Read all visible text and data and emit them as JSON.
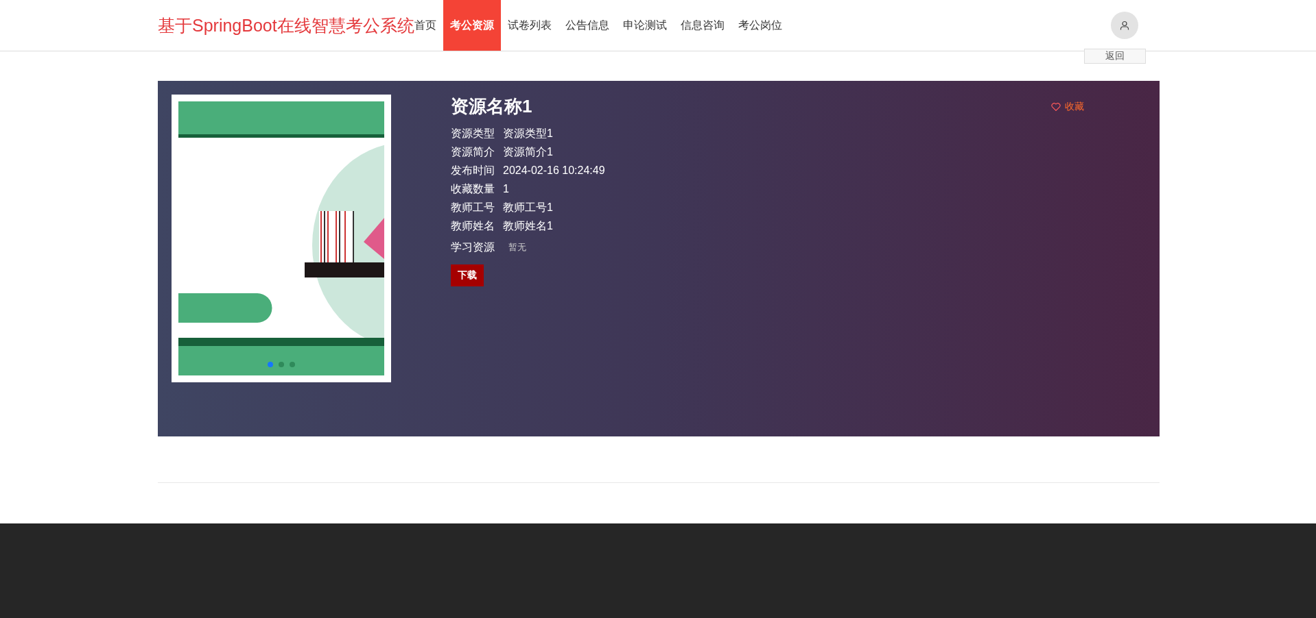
{
  "header": {
    "logo": "基于SpringBoot在线智慧考公系统",
    "nav": [
      {
        "label": "首页",
        "selected": false
      },
      {
        "label": "考公资源",
        "selected": true
      },
      {
        "label": "试卷列表",
        "selected": false
      },
      {
        "label": "公告信息",
        "selected": false
      },
      {
        "label": "申论测试",
        "selected": false
      },
      {
        "label": "信息咨询",
        "selected": false
      },
      {
        "label": "考公岗位",
        "selected": false
      }
    ]
  },
  "back_button": "返回",
  "detail": {
    "carousel": {
      "dots": [
        {
          "selected": true
        },
        {
          "selected": false
        },
        {
          "selected": false
        }
      ]
    },
    "title": "资源名称1",
    "favorite": "收藏",
    "fields": [
      {
        "label": "资源类型",
        "value": "资源类型1"
      },
      {
        "label": "资源简介",
        "value": "资源简介1"
      },
      {
        "label": "发布时间",
        "value": "2024-02-16 10:24:49"
      },
      {
        "label": "收藏数量",
        "value": "1"
      },
      {
        "label": "教师工号",
        "value": "教师工号1"
      },
      {
        "label": "教师姓名",
        "value": "教师姓名1"
      }
    ],
    "resource": {
      "label": "学习资源",
      "value": "暂无"
    },
    "download": "下载"
  }
}
